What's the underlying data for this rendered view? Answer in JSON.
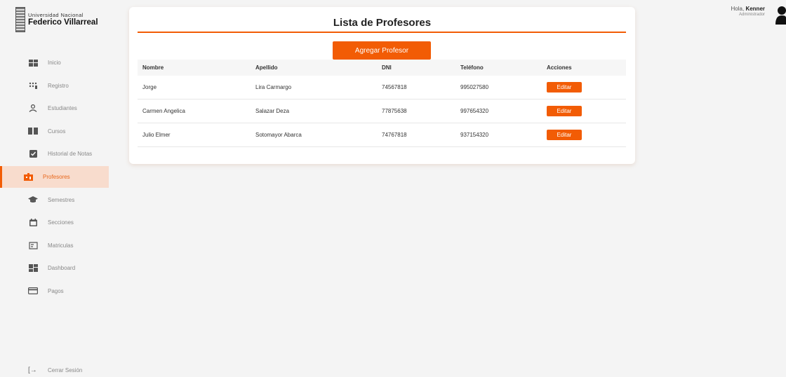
{
  "brand": {
    "sub": "Universidad Nacional",
    "main": "Federico Villarreal"
  },
  "nav": [
    {
      "label": "Inicio",
      "icon": "grid-icon"
    },
    {
      "label": "Registro",
      "icon": "dots-icon"
    },
    {
      "label": "Estudiantes",
      "icon": "person-icon"
    },
    {
      "label": "Cursos",
      "icon": "book-icon"
    },
    {
      "label": "Historial de Notas",
      "icon": "check-icon"
    },
    {
      "label": "Profesores",
      "icon": "teacher-icon",
      "active": true
    },
    {
      "label": "Semestres",
      "icon": "graduation-cap-icon"
    },
    {
      "label": "Secciones",
      "icon": "calendar-icon"
    },
    {
      "label": "Matriculas",
      "icon": "enroll-icon"
    },
    {
      "label": "Dashboard",
      "icon": "dashboard-icon"
    },
    {
      "label": "Pagos",
      "icon": "card-icon"
    }
  ],
  "logout": "Cerrar Sesión",
  "user": {
    "greeting": "Hola,",
    "name": "Kenner",
    "role": "Administrador"
  },
  "card": {
    "title": "Lista de Profesores",
    "add_label": "Agregar Profesor"
  },
  "table": {
    "headers": [
      "Nombre",
      "Apellido",
      "DNI",
      "Teléfono",
      "Acciones"
    ],
    "rows": [
      {
        "nombre": "Jorge",
        "apellido": "Lira Carmargo",
        "dni": "74567818",
        "telefono": "995027580",
        "accion": "Editar"
      },
      {
        "nombre": "Carmen Angelica",
        "apellido": "Salazar Deza",
        "dni": "77875638",
        "telefono": "997654320",
        "accion": "Editar"
      },
      {
        "nombre": "Julio Elmer",
        "apellido": "Sotomayor Abarca",
        "dni": "74767818",
        "telefono": "937154320",
        "accion": "Editar"
      }
    ]
  },
  "colors": {
    "accent": "#f25c05",
    "active_bg": "#f8dccd",
    "background": "#f4f4f4"
  }
}
